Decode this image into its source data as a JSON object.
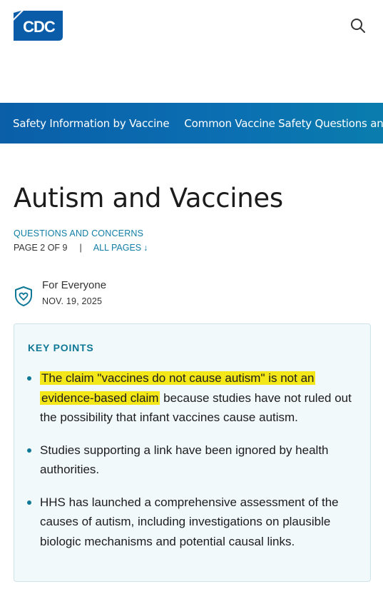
{
  "header": {
    "logo_text": "CDC",
    "logo_color": "#0a5ba8",
    "search_icon": "search-icon"
  },
  "nav": {
    "items": [
      {
        "label": "Safety Information by Vaccine"
      },
      {
        "label": "Common Vaccine Safety Questions and Concerns"
      }
    ]
  },
  "article": {
    "title": "Autism and Vaccines",
    "category": "QUESTIONS AND CONCERNS",
    "page_indicator": "PAGE 2 OF 9",
    "separator": "|",
    "all_pages_label": "ALL PAGES",
    "all_pages_arrow": "↓",
    "audience_icon": "heart-shield-icon",
    "audience_label": "For Everyone",
    "date": "NOV. 19, 2025"
  },
  "key_points": {
    "title": "KEY POINTS",
    "highlight_color": "#f4e719",
    "items": [
      {
        "highlighted": "The claim \"vaccines do not cause autism\" is not an evidence-based claim",
        "rest": " because studies have not ruled out the possibility that infant vaccines cause autism."
      },
      {
        "highlighted": "",
        "rest": "Studies supporting a link have been ignored by health authorities."
      },
      {
        "highlighted": "",
        "rest": "HHS has launched a comprehensive assessment of the causes of autism, including investigations on plausible biologic mechanisms and potential causal links."
      }
    ]
  }
}
